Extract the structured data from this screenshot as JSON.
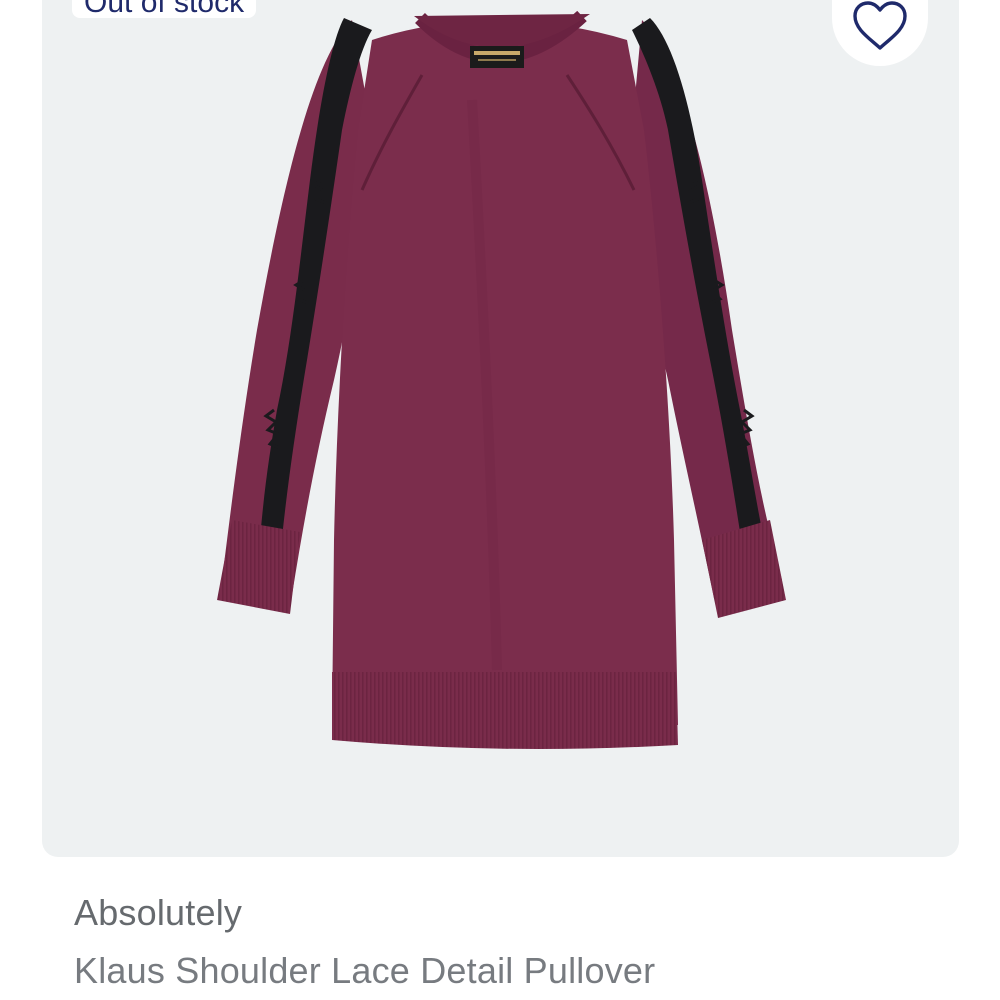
{
  "product": {
    "status_badge": "Out of stock",
    "brand": "Absolutely",
    "name": "Klaus Shoulder Lace Detail Pullover",
    "image_alt": "Burgundy knit pullover with black lace shoulder detail",
    "label_text": "ABSOLUTELY"
  },
  "icons": {
    "favorite": "heart-outline-icon"
  },
  "colors": {
    "card_bg": "#eef1f2",
    "badge_text": "#1f2a6b",
    "heart_stroke": "#1f2a6b",
    "sweater": "#7a2c4b",
    "lace": "#1a1a1d"
  }
}
